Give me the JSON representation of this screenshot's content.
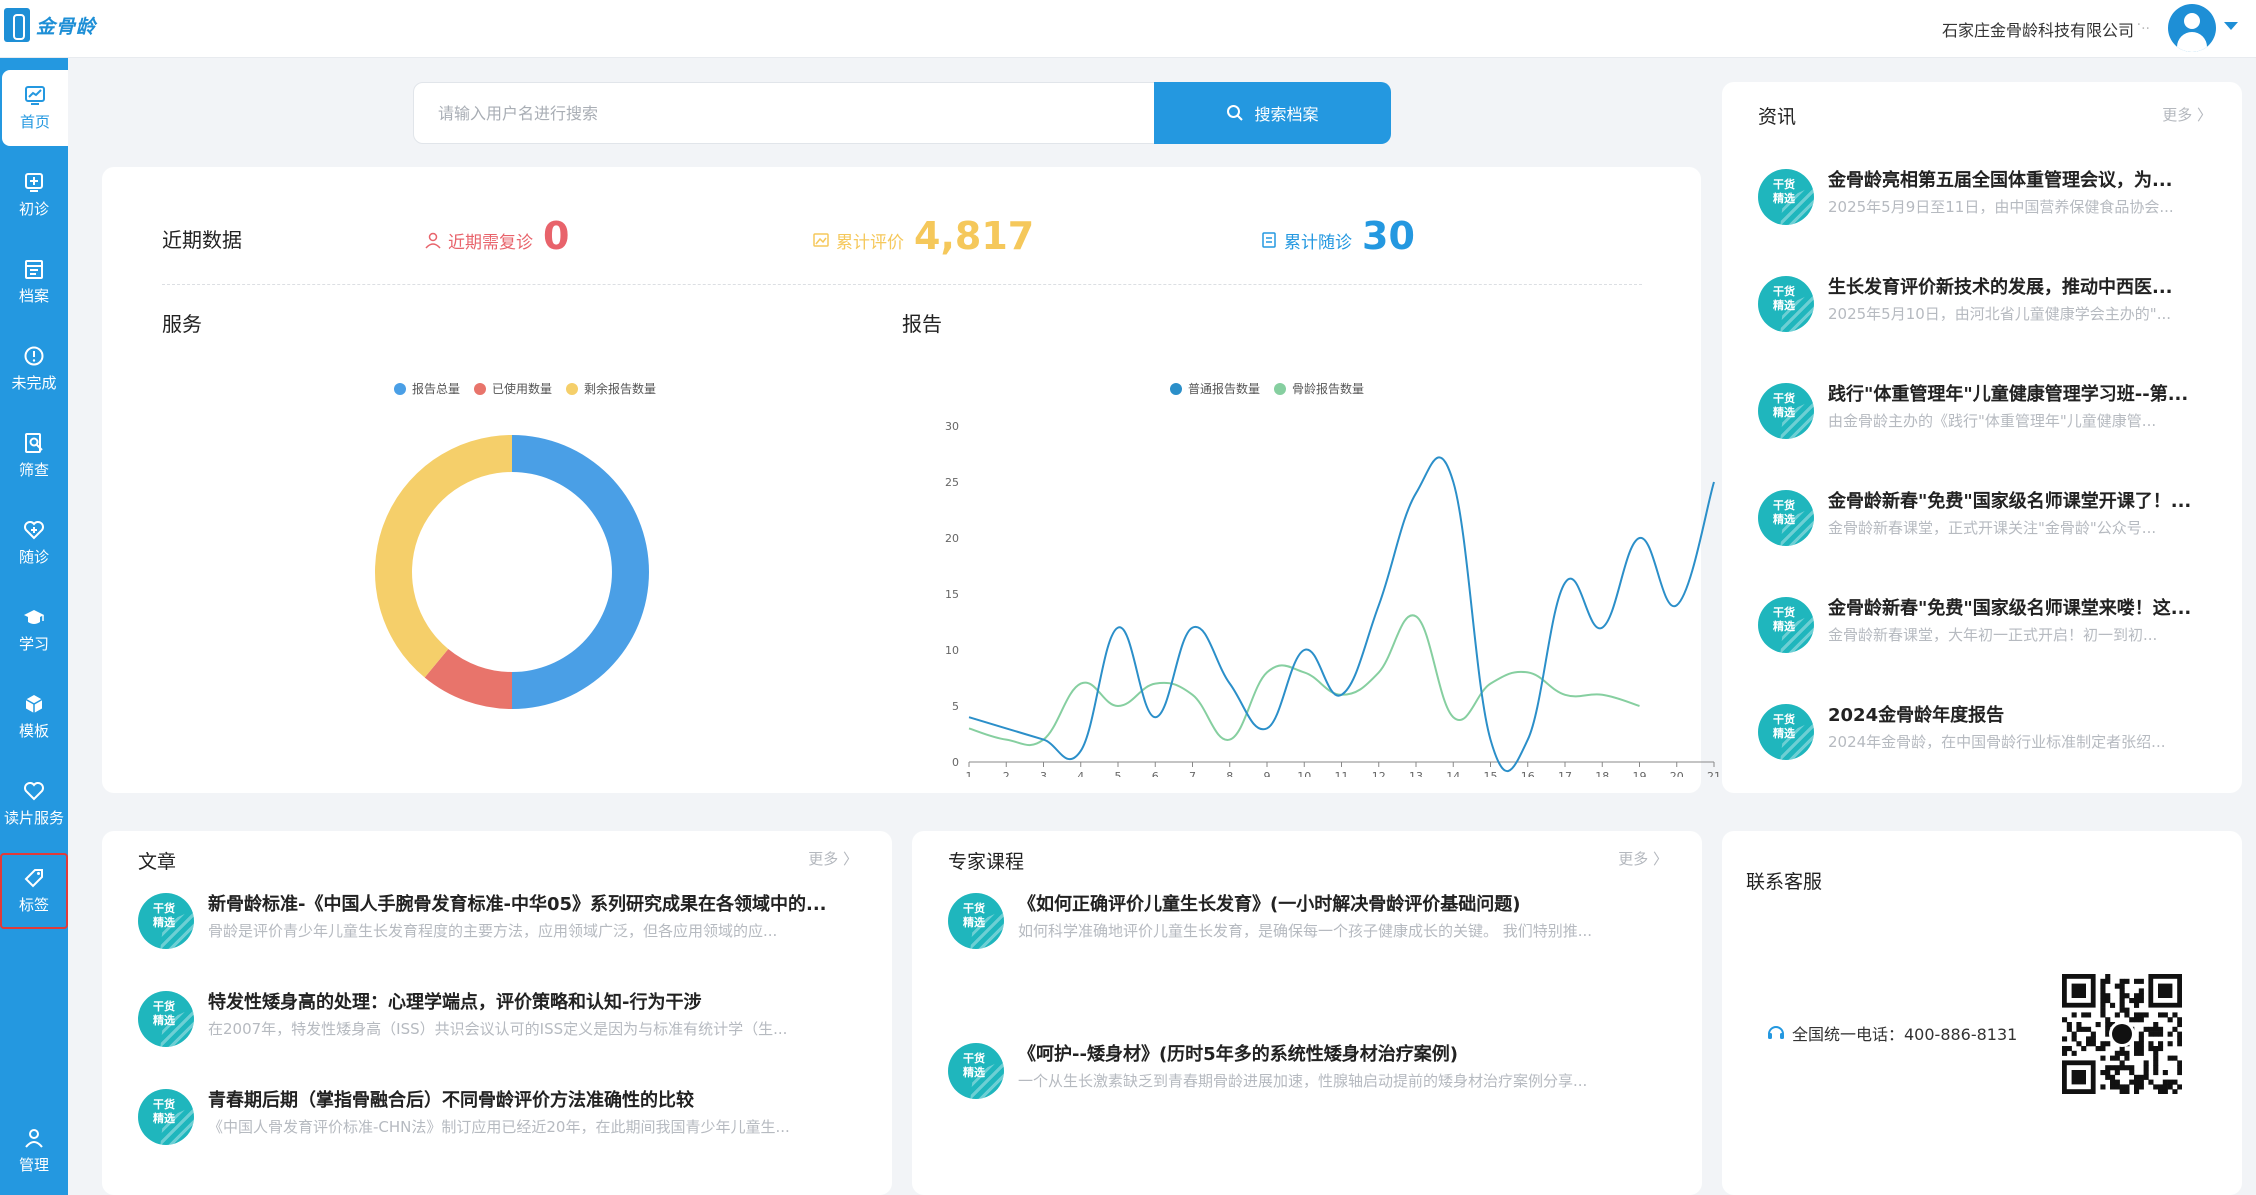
{
  "app": {
    "logo_text": "金骨龄"
  },
  "header": {
    "company": "石家庄金骨龄科技有限公司",
    "user_extra": "·..",
    "colors": {
      "primary": "#2498e0"
    }
  },
  "sidebar": {
    "items": [
      {
        "label": "首页",
        "icon": "dashboard-icon",
        "active": true
      },
      {
        "label": "初诊",
        "icon": "add-case-icon"
      },
      {
        "label": "档案",
        "icon": "archive-icon"
      },
      {
        "label": "未完成",
        "icon": "alert-circle-icon"
      },
      {
        "label": "筛查",
        "icon": "search-doc-icon"
      },
      {
        "label": "随诊",
        "icon": "heart-plus-icon"
      },
      {
        "label": "学习",
        "icon": "graduation-cap-icon"
      },
      {
        "label": "模板",
        "icon": "cube-icon"
      },
      {
        "label": "读片服务",
        "icon": "heart-icon"
      },
      {
        "label": "标签",
        "icon": "tag-icon",
        "highlighted": true
      },
      {
        "label": "管理",
        "icon": "user-icon"
      }
    ]
  },
  "search": {
    "placeholder": "请输入用户名进行搜索",
    "button_label": "搜索档案"
  },
  "stats": {
    "title": "近期数据",
    "items": [
      {
        "label": "近期需复诊",
        "value": "0",
        "color": "#e8636b",
        "icon": "person-icon"
      },
      {
        "label": "累计评价",
        "value": "4,817",
        "color": "#f5c85b",
        "icon": "image-icon"
      },
      {
        "label": "累计随诊",
        "value": "30",
        "color": "#2498e0",
        "icon": "document-icon"
      }
    ]
  },
  "service_chart": {
    "title": "服务",
    "chart_data": {
      "type": "pie",
      "series": [
        {
          "name": "报告总量",
          "value": 50,
          "color": "#4a9fe6"
        },
        {
          "name": "已使用数量",
          "value": 11,
          "color": "#e8746b"
        },
        {
          "name": "剩余报告数量",
          "value": 39,
          "color": "#f5cf6a"
        }
      ]
    }
  },
  "report_chart": {
    "title": "报告",
    "chart_data": {
      "type": "line",
      "x": [
        1,
        2,
        3,
        4,
        5,
        6,
        7,
        8,
        9,
        10,
        11,
        12,
        13,
        14,
        15,
        16,
        17,
        18,
        19,
        20,
        21
      ],
      "ylim": [
        0,
        30
      ],
      "yticks": [
        0,
        5,
        10,
        15,
        20,
        25,
        30
      ],
      "series": [
        {
          "name": "普通报告数量",
          "color": "#2b8fc9",
          "values": [
            4,
            3,
            2,
            1,
            12,
            4,
            12,
            7,
            3,
            10,
            6,
            14,
            24,
            25,
            2,
            2,
            16,
            12,
            20,
            14,
            25
          ]
        },
        {
          "name": "骨龄报告数量",
          "color": "#86cfa0",
          "values": [
            3,
            2,
            2,
            7,
            5,
            7,
            6,
            2,
            8,
            8,
            6,
            8,
            13,
            4,
            7,
            8,
            6,
            6,
            5
          ]
        }
      ]
    }
  },
  "news": {
    "title": "资讯",
    "more": "更多",
    "badge": "干货\n精选",
    "items": [
      {
        "title": "金骨龄亮相第五届全国体重管理会议，为...",
        "desc": "2025年5月9日至11日，由中国营养保健食品协会..."
      },
      {
        "title": "生长发育评价新技术的发展，推动中西医...",
        "desc": "2025年5月10日，由河北省儿童健康学会主办的\"..."
      },
      {
        "title": "践行\"体重管理年\"儿童健康管理学习班--第...",
        "desc": "由金骨龄主办的《践行\"体重管理年\"儿童健康管..."
      },
      {
        "title": "金骨龄新春\"免费\"国家级名师课堂开课了！...",
        "desc": "金骨龄新春课堂，正式开课关注\"金骨龄\"公众号..."
      },
      {
        "title": "金骨龄新春\"免费\"国家级名师课堂来喽！这...",
        "desc": "金骨龄新春课堂，大年初一正式开启！初一到初..."
      },
      {
        "title": "2024金骨龄年度报告",
        "desc": "2024年金骨龄，在中国骨龄行业标准制定者张绍..."
      }
    ]
  },
  "articles": {
    "title": "文章",
    "more": "更多",
    "items": [
      {
        "title": "新骨龄标准-《中国人手腕骨发育标准-中华05》系列研究成果在各领域中的...",
        "desc": "骨龄是评价青少年儿童生长发育程度的主要方法，应用领域广泛，但各应用领域的应..."
      },
      {
        "title": "特发性矮身高的处理：心理学端点，评价策略和认知-行为干涉",
        "desc": "在2007年，特发性矮身高（ISS）共识会议认可的ISS定义是因为与标准有统计学（生..."
      },
      {
        "title": "青春期后期（掌指骨融合后）不同骨龄评价方法准确性的比较",
        "desc": "《中国人骨发育评价标准-CHN法》制订应用已经近20年，在此期间我国青少年儿童生..."
      }
    ]
  },
  "courses": {
    "title": "专家课程",
    "more": "更多",
    "items": [
      {
        "title": "《如何正确评价儿童生长发育》(一小时解决骨龄评价基础问题)",
        "desc": "如何科学准确地评价儿童生长发育，是确保每一个孩子健康成长的关键。 我们特别推..."
      },
      {
        "title": "《呵护--矮身材》(历时5年多的系统性矮身材治疗案例)",
        "desc": "一个从生长激素缺乏到青春期骨龄进展加速，性腺轴启动提前的矮身材治疗案例分享..."
      }
    ]
  },
  "contact": {
    "title": "联系客服",
    "phone_label": "全国统一电话：400-886-8131",
    "qr_icon": "wechat-qr-icon"
  }
}
